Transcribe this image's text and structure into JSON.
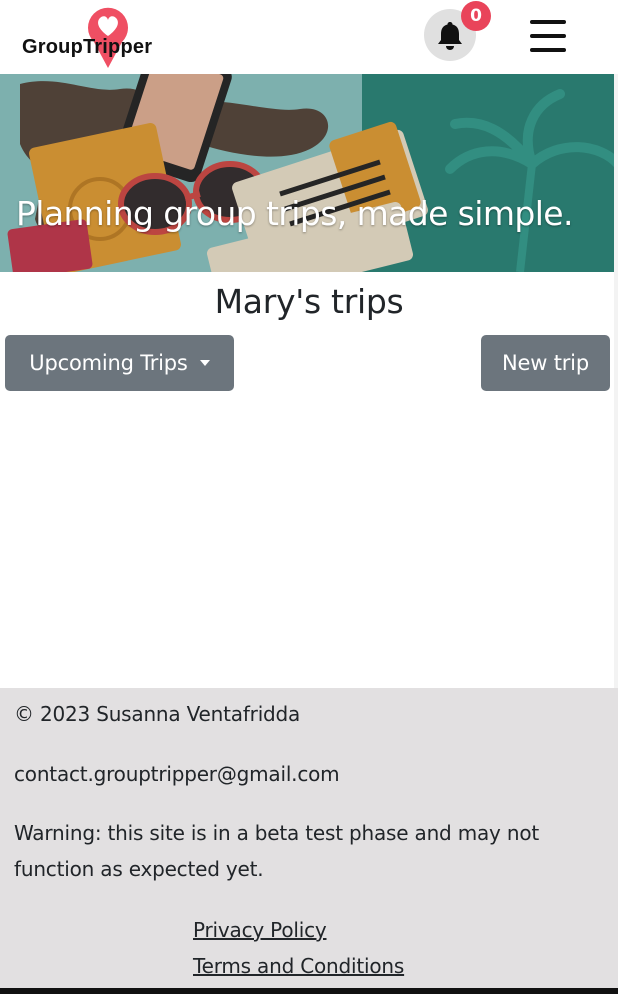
{
  "header": {
    "brand": "GroupTripper",
    "notification_count": "0",
    "icons": {
      "logo": "heart-pin-icon",
      "notifications": "bell-icon",
      "menu": "hamburger-menu-icon"
    },
    "colors": {
      "badge": "#e9445a",
      "pin": "#ef4f63"
    }
  },
  "hero": {
    "tagline": "Planning group trips, made simple.",
    "illustration": "travel flat-lay: map, passport, phone, sunglasses, boarding passes, palm tree"
  },
  "main": {
    "title": "Mary's trips",
    "filter_button": "Upcoming Trips",
    "new_trip_button": "New trip",
    "button_color": "#6c757d"
  },
  "footer": {
    "copyright": "© 2023 Susanna Ventafridda",
    "email": "contact.grouptripper@gmail.com",
    "warning": "Warning: this site is in a beta test phase and may not function as expected yet.",
    "links": {
      "privacy": "Privacy Policy",
      "terms": "Terms and Conditions"
    },
    "background": "#e2e0e1"
  }
}
